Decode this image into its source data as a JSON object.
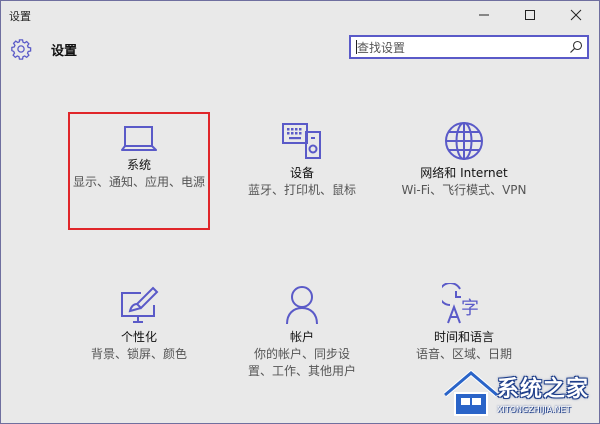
{
  "window": {
    "title": "设置"
  },
  "header": {
    "title": "设置"
  },
  "search": {
    "placeholder": "查找设置"
  },
  "tiles": [
    {
      "name": "系统",
      "desc": "显示、通知、应用、电源",
      "icon": "laptop-icon"
    },
    {
      "name": "设备",
      "desc": "蓝牙、打印机、鼠标",
      "icon": "devices-icon"
    },
    {
      "name": "网络和 Internet",
      "desc": "Wi-Fi、飞行模式、VPN",
      "icon": "globe-icon"
    },
    {
      "name": "个性化",
      "desc": "背景、锁屏、颜色",
      "icon": "personalization-icon"
    },
    {
      "name": "帐户",
      "desc": "你的帐户、同步设置、工作、其他用户",
      "icon": "person-icon"
    },
    {
      "name": "时间和语言",
      "desc": "语音、区域、日期",
      "icon": "time-language-icon"
    }
  ],
  "watermark": {
    "text": "系统之家",
    "subtext": "XITONGZHIJIA.NET"
  },
  "colors": {
    "accent": "#5a5ac8",
    "highlight": "#e0262a",
    "background": "#e9e9e9"
  }
}
